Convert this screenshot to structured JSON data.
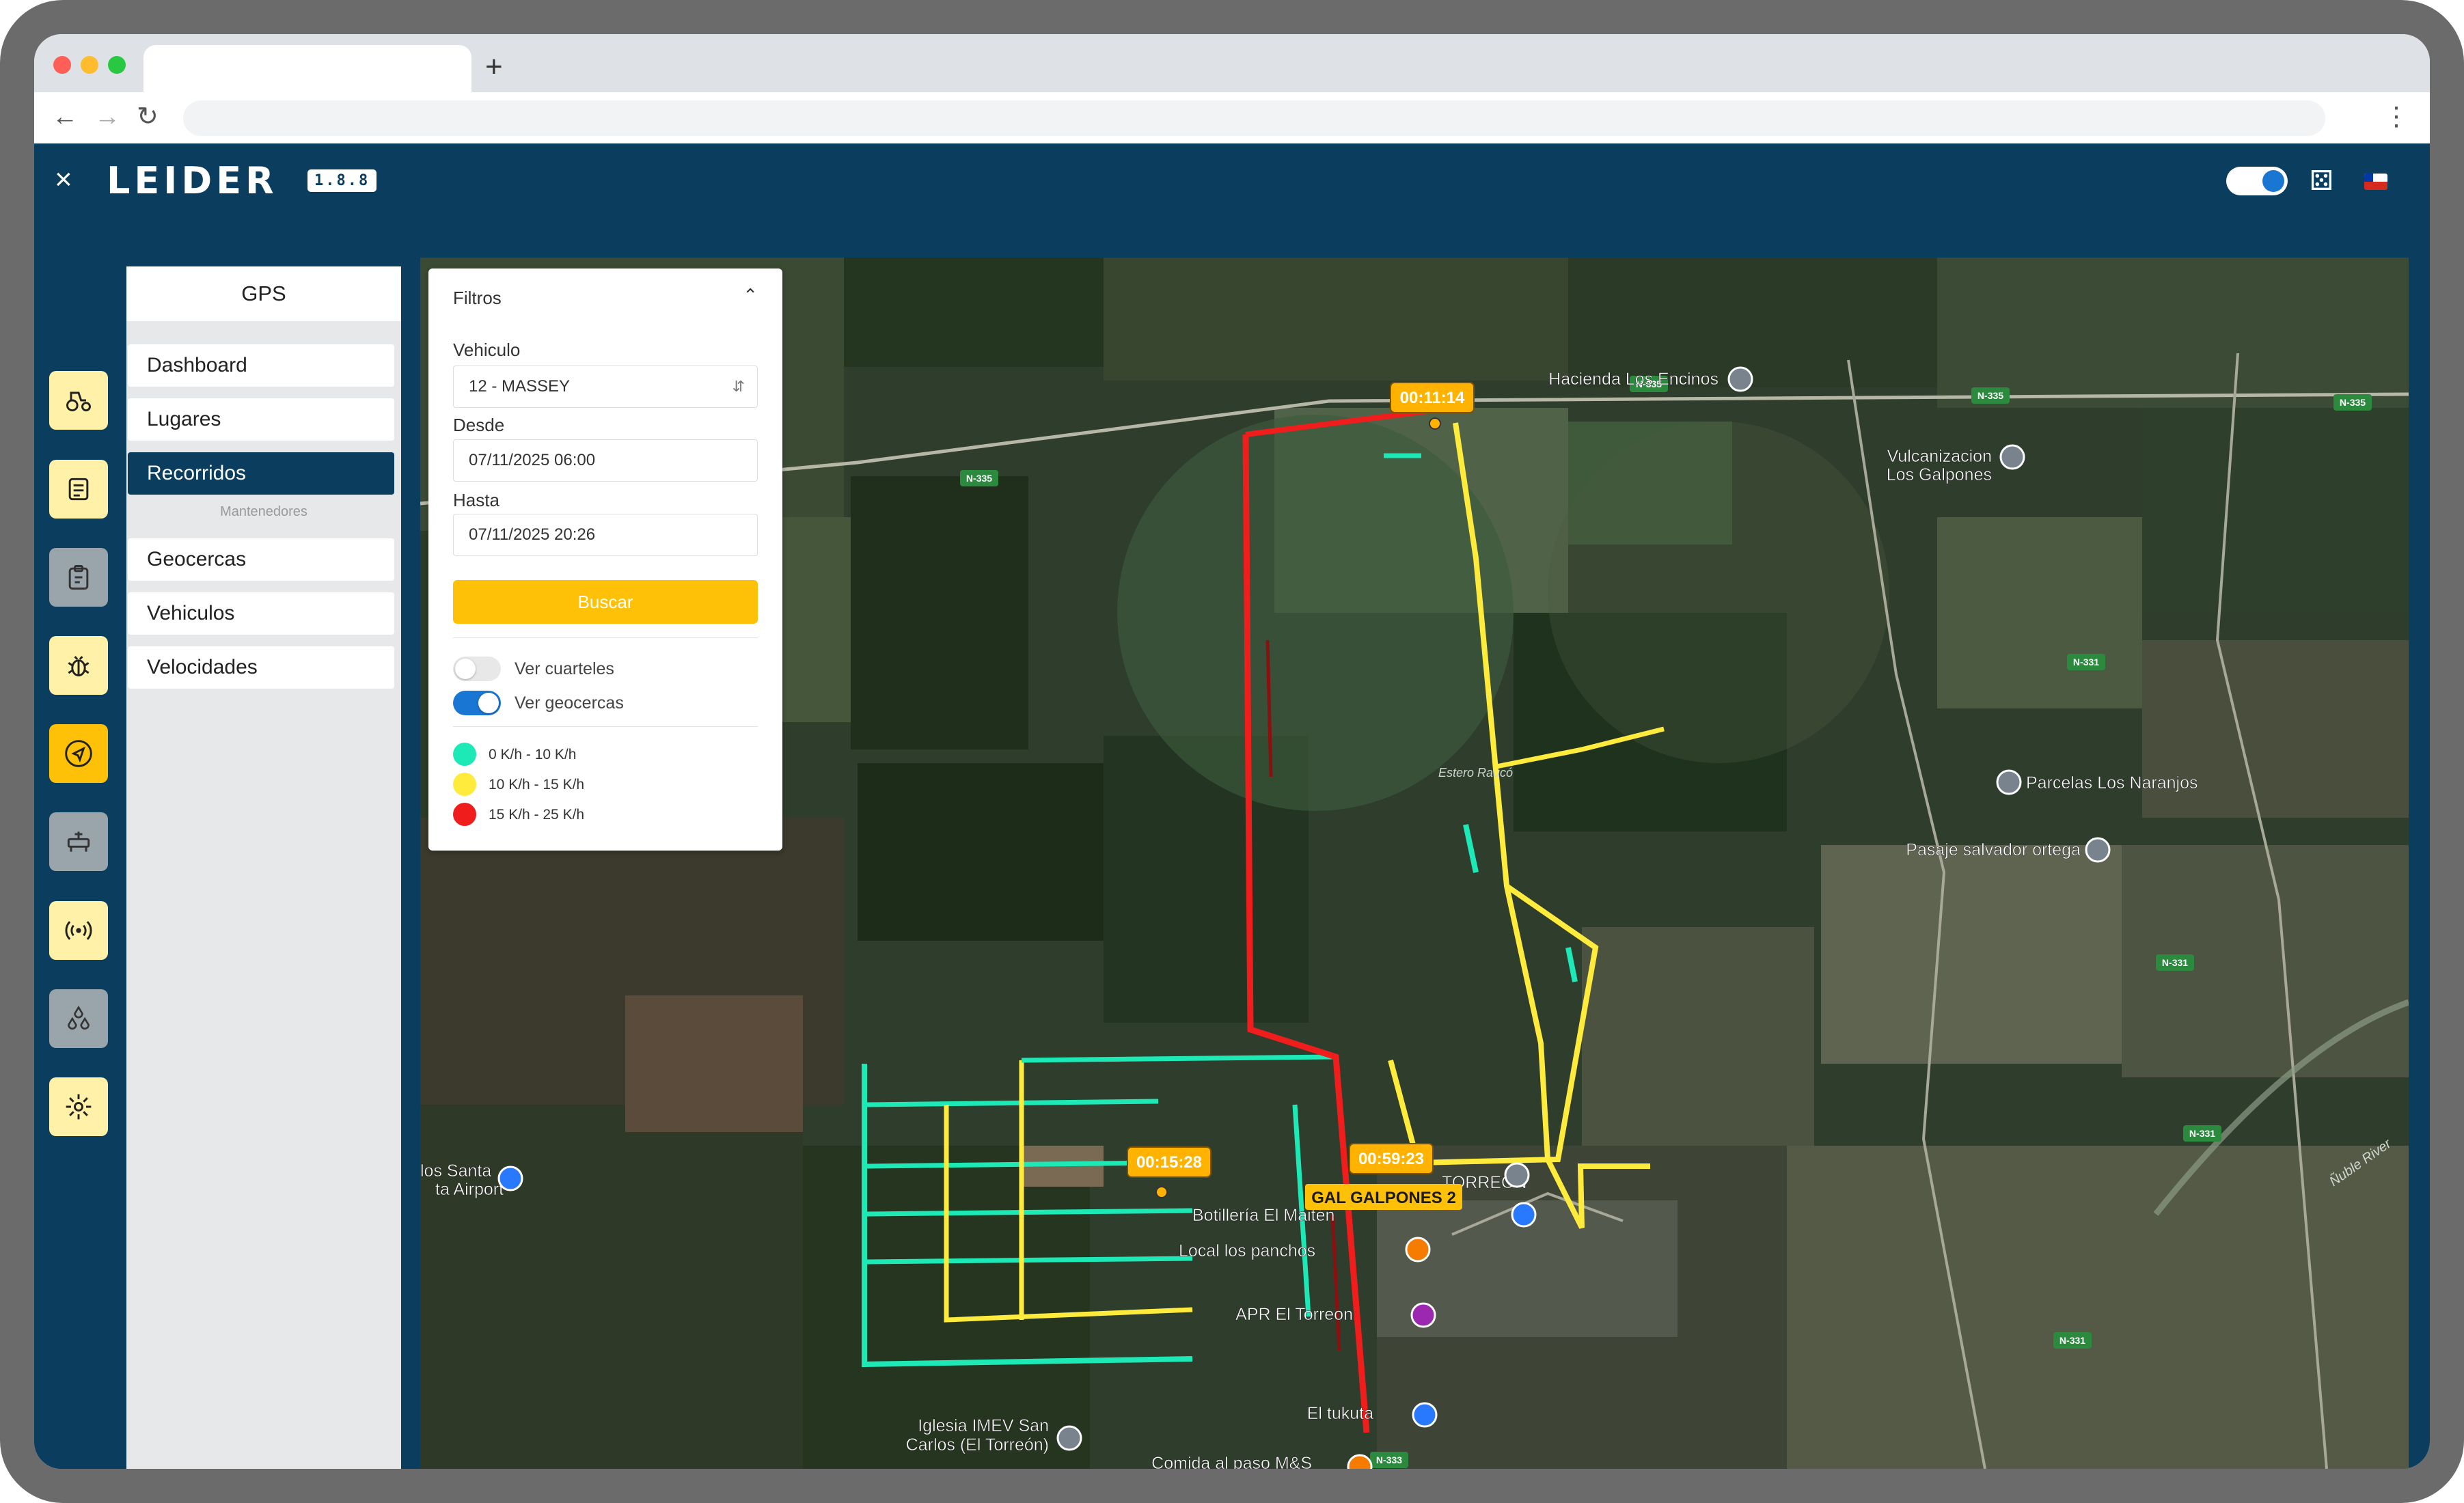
{
  "app": {
    "logo": "LEIDER",
    "version": "1.8.8"
  },
  "browser": {
    "new_tab": "+",
    "close": "×"
  },
  "submenu": {
    "title": "GPS",
    "items": [
      "Dashboard",
      "Lugares",
      "Recorridos"
    ],
    "section_label": "Mantenedores",
    "section_items": [
      "Geocercas",
      "Vehiculos",
      "Velocidades"
    ],
    "active": "Recorridos"
  },
  "sidebar_icons": [
    "tractor-icon",
    "document-icon",
    "clipboard-icon",
    "bug-icon",
    "navigation-icon",
    "water-tank-icon",
    "signal-icon",
    "drops-icon",
    "gear-icon"
  ],
  "filters": {
    "title": "Filtros",
    "vehicle_label": "Vehiculo",
    "vehicle_value": "12 - MASSEY",
    "from_label": "Desde",
    "from_value": "07/11/2025 06:00",
    "to_label": "Hasta",
    "to_value": "07/11/2025 20:26",
    "search_button": "Buscar",
    "toggle_cuarteles": {
      "label": "Ver cuarteles",
      "on": false
    },
    "toggle_geocercas": {
      "label": "Ver geocercas",
      "on": true
    },
    "legend": [
      {
        "label": "0 K/h - 10 K/h",
        "color": "#1de9b6"
      },
      {
        "label": "10 K/h - 15 K/h",
        "color": "#ffeb3b"
      },
      {
        "label": "15 K/h - 25 K/h",
        "color": "#f01d1d"
      }
    ]
  },
  "map": {
    "places": [
      "Hacienda Los Encinos",
      "Vulcanizacion",
      "Los Galpones",
      "Parcelas Los Naranjos",
      "Pasaje salvador ortega",
      "Botillería El Maitén",
      "Local los panchos",
      "APR El Torreon",
      "El tukuta",
      "Iglesia IMEV San",
      "Carlos (El Torreón)",
      "Comida al paso M&S",
      "los Santa",
      "ta Airport",
      "TORREÓN",
      "Estero Raucó",
      "Ñuble River"
    ],
    "road_labels": [
      "N-335",
      "N-335",
      "N-335",
      "N-335",
      "N-331",
      "N-331",
      "N-331",
      "N-331",
      "N-333"
    ],
    "time_badges": [
      "00:11:14",
      "00:15:28",
      "00:59:23"
    ],
    "geofence_label": "GAL GALPONES 2",
    "colors": {
      "slow": "#1de9b6",
      "medium": "#ffeb3b",
      "fast": "#f01d1d"
    }
  }
}
